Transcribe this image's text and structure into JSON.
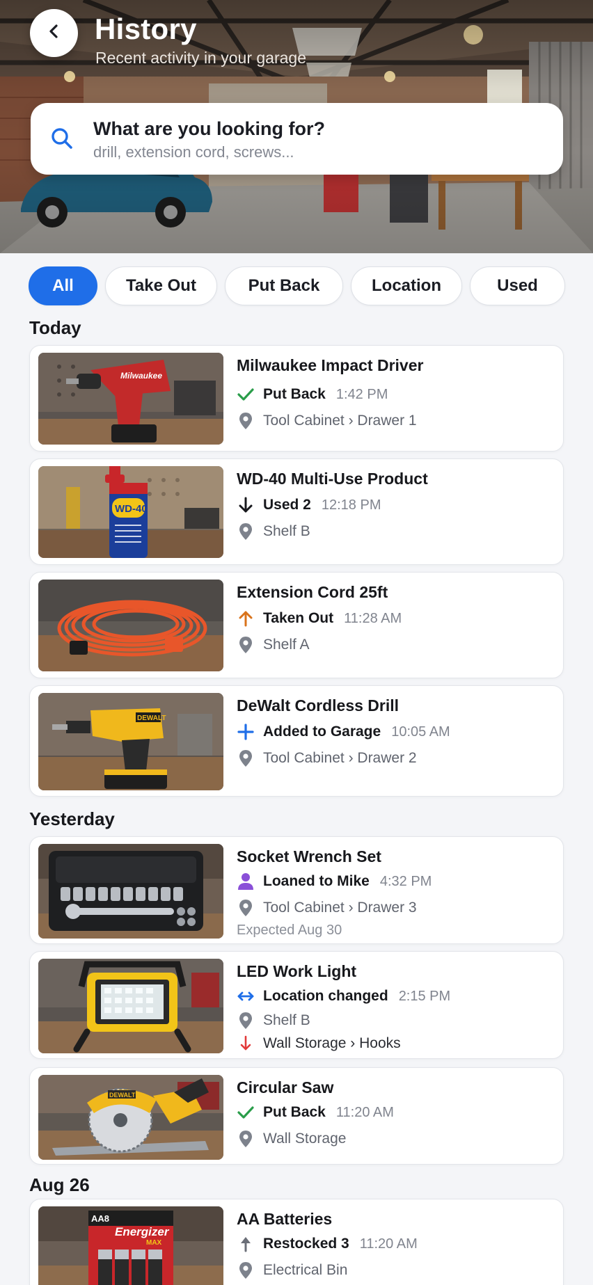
{
  "header": {
    "title": "History",
    "subtitle": "Recent activity in your garage"
  },
  "search": {
    "title": "What are you looking for?",
    "placeholder": "drill, extension cord, screws..."
  },
  "filters": [
    "All",
    "Take Out",
    "Put Back",
    "Location",
    "Used"
  ],
  "active_filter": "All",
  "sections": [
    {
      "label": "Today",
      "items": [
        {
          "name": "Milwaukee Impact Driver",
          "action_icon": "check-icon",
          "action": "Put Back",
          "time": "1:42 PM",
          "location": "Tool Cabinet › Drawer 1",
          "thumbnail": "impact-driver-photo"
        },
        {
          "name": "WD-40 Multi-Use Product",
          "action_icon": "arrow-down-icon",
          "action": "Used 2",
          "time": "12:18 PM",
          "location": "Shelf B",
          "thumbnail": "wd40-can-photo"
        },
        {
          "name": "Extension Cord 25ft",
          "action_icon": "arrow-up-icon",
          "action": "Taken Out",
          "time": "11:28 AM",
          "location": "Shelf A",
          "thumbnail": "extension-cord-photo"
        },
        {
          "name": "DeWalt Cordless Drill",
          "action_icon": "plus-icon",
          "action": "Added to Garage",
          "time": "10:05 AM",
          "location": "Tool Cabinet › Drawer 2",
          "thumbnail": "cordless-drill-photo"
        }
      ]
    },
    {
      "label": "Yesterday",
      "items": [
        {
          "name": "Socket Wrench Set",
          "action_icon": "person-icon",
          "action": "Loaned to Mike",
          "time": "4:32 PM",
          "location": "Tool Cabinet › Drawer 3",
          "note": "Expected Aug 30",
          "thumbnail": "socket-set-photo"
        },
        {
          "name": "LED Work Light",
          "action_icon": "swap-arrows-icon",
          "action": "Location changed",
          "time": "2:15 PM",
          "location": "Shelf B",
          "new_location": "Wall Storage › Hooks",
          "thumbnail": "work-light-photo"
        },
        {
          "name": "Circular Saw",
          "action_icon": "check-icon",
          "action": "Put Back",
          "time": "11:20 AM",
          "location": "Wall Storage",
          "thumbnail": "circular-saw-photo"
        }
      ]
    },
    {
      "label": "Aug 26",
      "items": [
        {
          "name": "AA Batteries",
          "action_icon": "arrow-up-icon",
          "action": "Restocked 3",
          "time": "11:20 AM",
          "location": "Electrical Bin",
          "thumbnail": "batteries-photo"
        }
      ]
    }
  ],
  "thumbnail_labels": {
    "milwaukee": "Milwaukee",
    "wd40": "WD-40",
    "dewalt": "DEWALT",
    "energizer": "Energizer",
    "aa": "AA8",
    "max": "MAX"
  },
  "colors": {
    "accent": "#1f6ee8",
    "success": "#2a9d4a",
    "orange": "#d9731b",
    "purple": "#8a4fd8",
    "red": "#e23a3a",
    "location_pin": "#7d828c"
  }
}
